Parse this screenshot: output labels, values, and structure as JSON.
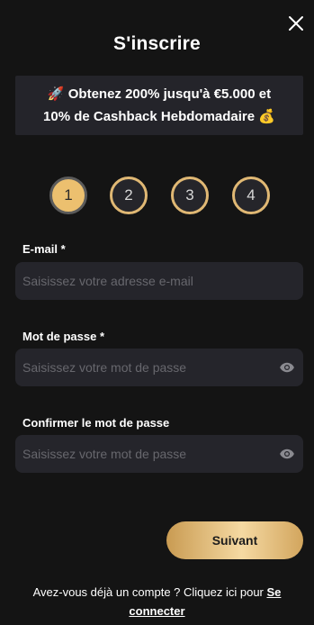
{
  "modal": {
    "title": "S'inscrire"
  },
  "promo": {
    "icon_start": "🚀",
    "line1": "Obtenez 200% jusqu'à €5.000 et",
    "line2": "10% de Cashback Hebdomadaire",
    "icon_end": "💰"
  },
  "steps": [
    {
      "label": "1",
      "active": true
    },
    {
      "label": "2",
      "active": false
    },
    {
      "label": "3",
      "active": false
    },
    {
      "label": "4",
      "active": false
    }
  ],
  "form": {
    "email": {
      "label": "E-mail *",
      "placeholder": "Saisissez votre adresse e-mail",
      "value": ""
    },
    "password": {
      "label": "Mot de passe *",
      "placeholder": "Saisissez votre mot de passe",
      "value": ""
    },
    "confirm": {
      "label": "Confirmer le mot de passe",
      "placeholder": "Saisissez votre mot de passe",
      "value": ""
    }
  },
  "submit_label": "Suivant",
  "footer": {
    "text": "Avez-vous déjà un compte ? Cliquez ici pour ",
    "link": "Se connecter"
  },
  "colors": {
    "accent": "#e0b874",
    "background": "#141414",
    "field": "#25252b"
  }
}
